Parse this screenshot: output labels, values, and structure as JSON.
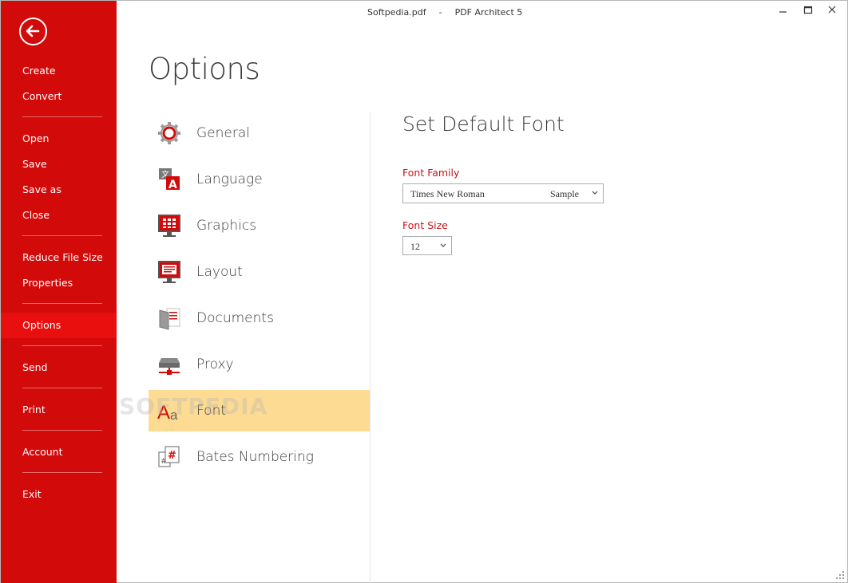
{
  "window": {
    "file_name": "Softpedia.pdf",
    "separator": "-",
    "app_name": "PDF Architect 5"
  },
  "sidebar": {
    "items": [
      {
        "label": "Create"
      },
      {
        "label": "Convert"
      },
      {
        "label": "Open"
      },
      {
        "label": "Save"
      },
      {
        "label": "Save as"
      },
      {
        "label": "Close"
      },
      {
        "label": "Reduce File Size"
      },
      {
        "label": "Properties"
      },
      {
        "label": "Options",
        "active": true
      },
      {
        "label": "Send"
      },
      {
        "label": "Print"
      },
      {
        "label": "Account"
      },
      {
        "label": "Exit"
      }
    ]
  },
  "page": {
    "title": "Options"
  },
  "options_list": [
    {
      "label": "General",
      "icon": "gear-icon"
    },
    {
      "label": "Language",
      "icon": "language-icon"
    },
    {
      "label": "Graphics",
      "icon": "graphics-monitor-icon"
    },
    {
      "label": "Layout",
      "icon": "layout-monitor-icon"
    },
    {
      "label": "Documents",
      "icon": "documents-icon"
    },
    {
      "label": "Proxy",
      "icon": "proxy-server-icon"
    },
    {
      "label": "Font",
      "icon": "font-icon",
      "selected": true
    },
    {
      "label": "Bates Numbering",
      "icon": "bates-numbering-icon"
    }
  ],
  "panel": {
    "title": "Set Default Font",
    "font_family_label": "Font Family",
    "font_family_value": "Times New Roman",
    "font_family_sample": "Sample",
    "font_size_label": "Font Size",
    "font_size_value": "12"
  },
  "watermark": "SOFTPEDIA",
  "colors": {
    "sidebar": "#d20a0a",
    "sidebar_active": "#e90f0f",
    "selected_row": "#fddb92",
    "label_red": "#c4161c"
  }
}
